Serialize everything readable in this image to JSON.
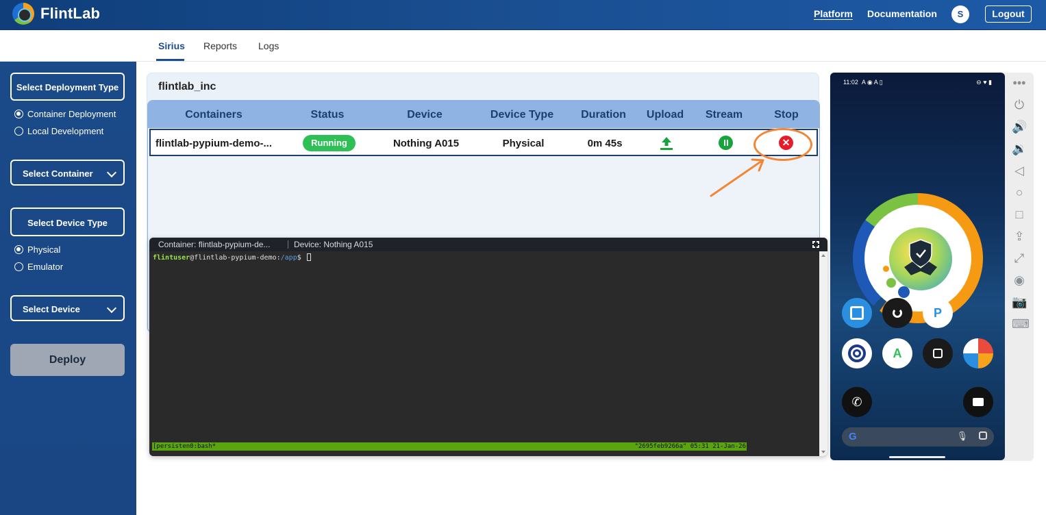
{
  "header": {
    "brand": "FlintLab",
    "nav": {
      "platform": "Platform",
      "documentation": "Documentation"
    },
    "avatar_initial": "S",
    "logout": "Logout"
  },
  "tabs": [
    {
      "label": "Sirius",
      "active": true
    },
    {
      "label": "Reports",
      "active": false
    },
    {
      "label": "Logs",
      "active": false
    }
  ],
  "sidebar": {
    "deployment_type_button": "Select Deployment Type",
    "deployment_options": [
      {
        "label": "Container Deployment",
        "selected": true
      },
      {
        "label": "Local Development",
        "selected": false
      }
    ],
    "container_select": "Select Container",
    "device_type_button": "Select Device Type",
    "device_type_options": [
      {
        "label": "Physical",
        "selected": true
      },
      {
        "label": "Emulator",
        "selected": false
      }
    ],
    "device_select": "Select Device",
    "deploy_button": "Deploy"
  },
  "panel": {
    "org": "flintlab_inc",
    "columns": [
      "Containers",
      "Status",
      "Device",
      "Device Type",
      "Duration",
      "Upload",
      "Stream",
      "Stop"
    ],
    "rows": [
      {
        "container": "flintlab-pypium-demo-...",
        "status": "Running",
        "device": "Nothing A015",
        "device_type": "Physical",
        "duration": "0m 45s",
        "upload_icon": "upload-icon",
        "stream_icon": "pause-icon",
        "stop_icon": "close-icon",
        "stop_symbol": "✕"
      }
    ]
  },
  "terminal": {
    "container_label": "Container:  flintlab-pypium-de...",
    "device_label": "Device:  Nothing A015",
    "prompt_user": "flintuser",
    "prompt_host": "@flintlab-pypium-demo:",
    "prompt_path": "/app",
    "prompt_suffix": "$ ",
    "status_left": "[persisten0:bash*",
    "status_right": "\"2695feb9266a\" 05:31 21-Jan-26"
  },
  "phone": {
    "status_time": "11:02",
    "status_left_icons": "A ◉ A ▯",
    "status_right_icons": "⊖ ♥ ▮",
    "search_logo": "G",
    "app_letters": [
      "P",
      "A"
    ],
    "side_controls": [
      "more-icon",
      "power-icon",
      "volume-up-icon",
      "volume-down-icon",
      "back-icon",
      "home-icon",
      "overview-icon",
      "upload-icon",
      "expand-icon",
      "record-icon",
      "camera-icon",
      "keyboard-icon"
    ]
  },
  "colors": {
    "header_bg": "#1a4f92",
    "sidebar_bg": "#1b4a88",
    "running": "#2fbf57",
    "stop": "#e51c2c",
    "annotation": "#f28634"
  }
}
